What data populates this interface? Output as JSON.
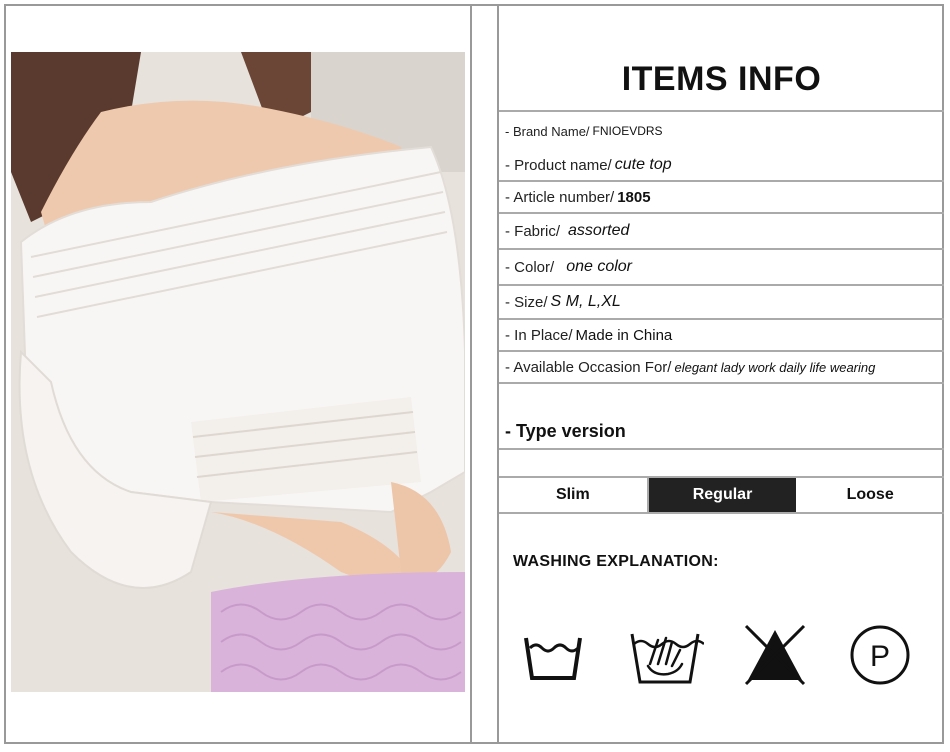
{
  "info": {
    "title": "ITEMS INFO",
    "rows": [
      {
        "key": "- Brand Name/",
        "value": "FNIOEVDRS"
      },
      {
        "key": "- Product name/",
        "value": "cute top"
      },
      {
        "key": "- Article number/",
        "value": "1805"
      },
      {
        "key": "- Fabric/",
        "value": "assorted"
      },
      {
        "key": "- Color/",
        "value": "one color"
      },
      {
        "key": "- Size/",
        "value": "S M, L,XL"
      },
      {
        "key": "- In Place/",
        "value": "Made in China"
      },
      {
        "key": "- Available Occasion For/",
        "value": "elegant lady work daily life wearing"
      }
    ],
    "type_version_label": "- Type version",
    "tabs": [
      "Slim",
      "Regular",
      "Loose"
    ],
    "active_tab": "Regular"
  },
  "washing": {
    "title": "WASHING EXPLANATION:",
    "icons": [
      "wash-tub-icon",
      "hand-wash-icon",
      "no-bleach-icon",
      "dry-clean-p-icon"
    ],
    "p_letter": "P"
  },
  "colors": {
    "border": "#999999",
    "active_tab": "#222222",
    "skirt": "#d9b3d9"
  }
}
